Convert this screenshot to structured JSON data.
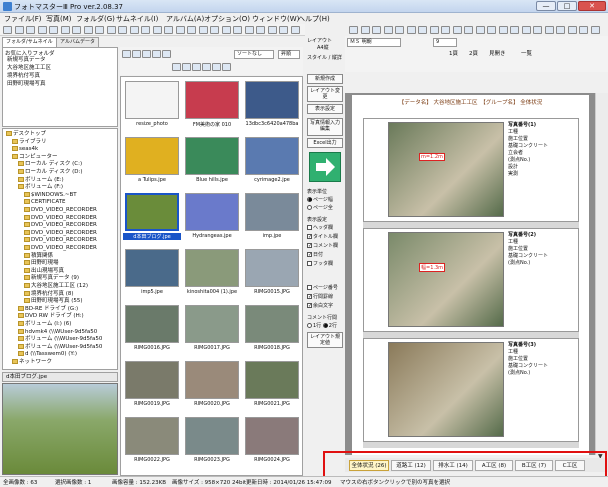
{
  "window": {
    "title": "フォトマスターⅢ Pro ver.2.08.37",
    "buttons": [
      "—",
      "□",
      "✕"
    ]
  },
  "menu": [
    "ファイル(F)",
    "写真(M)",
    "フォルダ(G)",
    "サムネイル(I)",
    "アルバム(A)",
    "オプション(O)",
    "ウィンドウ(W)",
    "ヘルプ(H)"
  ],
  "left_tabs": [
    "フォルダ/サムネイル",
    "アルバムデータ"
  ],
  "favorites": {
    "header": "お気に入りフォルダ",
    "items": [
      "新規写真データ",
      "大谷地区施工工区",
      "境界杭付写真",
      "田野町現場写真"
    ]
  },
  "tree": [
    {
      "label": "デスクトップ",
      "level": 0
    },
    {
      "label": "ライブラリ",
      "level": 1
    },
    {
      "label": "seas4k",
      "level": 1
    },
    {
      "label": "コンピューター",
      "level": 1
    },
    {
      "label": "ローカル ディスク (C:)",
      "level": 2
    },
    {
      "label": "ローカル ディスク (D:)",
      "level": 2
    },
    {
      "label": "ボリューム (E:)",
      "level": 2
    },
    {
      "label": "ボリューム (F:)",
      "level": 2
    },
    {
      "label": "$WINDOWS.~BT",
      "level": 3
    },
    {
      "label": "CERTIFICATE",
      "level": 3
    },
    {
      "label": "DVD_VIDEO_RECORDER",
      "level": 3
    },
    {
      "label": "DVD_VIDEO_RECORDER",
      "level": 3
    },
    {
      "label": "DVD_VIDEO_RECORDER",
      "level": 3
    },
    {
      "label": "DVD_VIDEO_RECORDER",
      "level": 3
    },
    {
      "label": "DVD_VIDEO_RECORDER",
      "level": 3
    },
    {
      "label": "DVD_VIDEO_RECORDER",
      "level": 3
    },
    {
      "label": "積算関係",
      "level": 3
    },
    {
      "label": "田野町現場",
      "level": 3
    },
    {
      "label": "出山現場写真",
      "level": 3
    },
    {
      "label": "新規写真データ (9)",
      "level": 3
    },
    {
      "label": "大谷地区施工工区 (12)",
      "level": 3
    },
    {
      "label": "境界杭付写真 (8)",
      "level": 3
    },
    {
      "label": "田野町現場写真 (55)",
      "level": 3
    },
    {
      "label": "BD-RE ドライブ (G:)",
      "level": 2
    },
    {
      "label": "DVD RW ドライブ (H:)",
      "level": 2
    },
    {
      "label": "ボリューム (I:) (6)",
      "level": 2
    },
    {
      "label": "hdvmk4 (\\\\WUser-9d5fa50",
      "level": 2
    },
    {
      "label": "ボリューム (\\\\WUser-9d5fa50",
      "level": 2
    },
    {
      "label": "ボリューム (\\\\WUser-9d5fa50",
      "level": 2
    },
    {
      "label": "d (\\\\Tasswem0) (Y:)",
      "level": 2
    },
    {
      "label": "ネットワーク",
      "level": 1
    }
  ],
  "preview_title": "d本田ブログ.jpe",
  "thumb_toolbar": {
    "sort": "ソートなし",
    "order": "昇順"
  },
  "thumbnails": [
    {
      "name": "resize_photo",
      "color": "#f4f4f4"
    },
    {
      "name": "FM美術の家 010",
      "color": "#c73c4e"
    },
    {
      "name": "13dbc3c6420a478ba",
      "color": "#3d5a8a"
    },
    {
      "name": "a Tulips.jpe",
      "color": "#e0b020"
    },
    {
      "name": "Blue hills.jpe",
      "color": "#3a8a5a"
    },
    {
      "name": "cyrimage2.jpe",
      "color": "#5a7ab0"
    },
    {
      "name": "d本田ブログ.jpe",
      "color": "#6a8c3a",
      "selected": true
    },
    {
      "name": "Hydrangeas.jpe",
      "color": "#6a7acb"
    },
    {
      "name": "imp.jpe",
      "color": "#7a8a9a"
    },
    {
      "name": "imp5.jpe",
      "color": "#4a6a8a"
    },
    {
      "name": "kinoshita004 (1).jpe",
      "color": "#8a9a7a"
    },
    {
      "name": "RIMG0015.JPG",
      "color": "#9aa6b2"
    },
    {
      "name": "RIMG0016.JPG",
      "color": "#6a7a6a"
    },
    {
      "name": "RIMG0017.JPG",
      "color": "#8a9a8a"
    },
    {
      "name": "RIMG0018.JPG",
      "color": "#7a8a7a"
    },
    {
      "name": "RIMG0019.JPG",
      "color": "#7a7a6a"
    },
    {
      "name": "RIMG0020.JPG",
      "color": "#9a8a7a"
    },
    {
      "name": "RIMG0021.JPG",
      "color": "#6a7a5a"
    },
    {
      "name": "RIMG0022.JPG",
      "color": "#8a8a7a"
    },
    {
      "name": "RIMG0023.JPG",
      "color": "#7a8a8a"
    },
    {
      "name": "RIMG0024.JPG",
      "color": "#8a7a7a"
    }
  ],
  "controls": {
    "new_layout": "新規作成",
    "layout_change": "レイアウト変更",
    "table_settings": "表示設定",
    "photo_info": "写真情報入力編集",
    "excel_output": "Excel出力",
    "display_unit_label": "表示単位",
    "display_units": [
      "ページ幅",
      "ページ全"
    ],
    "display_settings_label": "表示設定",
    "display_items": [
      {
        "label": "ヘッダ欄",
        "checked": false
      },
      {
        "label": "タイトル欄",
        "checked": true
      },
      {
        "label": "コメント欄",
        "checked": true
      },
      {
        "label": "日付",
        "checked": true
      },
      {
        "label": "フッタ欄",
        "checked": false
      }
    ],
    "other_items": [
      {
        "label": "ページ番号",
        "checked": false
      },
      {
        "label": "行間罫線",
        "checked": true
      },
      {
        "label": "余白文字",
        "checked": true
      }
    ],
    "comment_lines_label": "コメント行間",
    "comment_lines": [
      "1行",
      "2行"
    ],
    "layout_reset": "レイアウト規定値"
  },
  "right_toolbar": {
    "layout_label": "レイアウト",
    "paper": "A4縦",
    "style_label": "スタイル / 縦詳",
    "font": "ＭＳ 明朝",
    "size": "9",
    "buttons": [
      "1頁",
      "2頁",
      "見開き",
      "一覧"
    ]
  },
  "page": {
    "header": "【データ名】 大谷地区施工工区　【グループ名】 全体状況",
    "rows": [
      {
        "title": "写真番号(1)",
        "lines": [
          "工種",
          "施工位置",
          "基礎コンクリート",
          "立会者",
          "(測点No.)",
          "設計",
          "実測"
        ],
        "color": "#6a7a5a",
        "tag": "m=1.2m"
      },
      {
        "title": "写真番号(2)",
        "lines": [
          "工種",
          "施工位置",
          "基礎コンクリート",
          "(測点No.)"
        ],
        "color": "#7a8a6a",
        "tag": "幅=1.3m"
      },
      {
        "title": "写真番号(3)",
        "lines": [
          "工種",
          "施工位置",
          "基礎コンクリート",
          "(測点No.)"
        ],
        "color": "#8a7a5a",
        "tag": ""
      }
    ]
  },
  "bottom_tabs": [
    {
      "label": "全体状況 (26)",
      "active": true
    },
    {
      "label": "道路工 (12)",
      "active": false
    },
    {
      "label": "排水工 (14)",
      "active": false
    },
    {
      "label": "A工区 (8)",
      "active": false
    },
    {
      "label": "B工区 (7)",
      "active": false
    },
    {
      "label": "C工区",
      "active": false
    }
  ],
  "status": {
    "total_count": "全画像数 : 63",
    "selected": "選択画像数 : 1",
    "size": "画像容量 : 152.23KB",
    "dimensions": "画像サイズ : 958×720 24bit",
    "modified": "更新日時 : 2014/01/26 15:47:09",
    "hint": "マウスの右ボタンクリックで別の写真を選択"
  }
}
